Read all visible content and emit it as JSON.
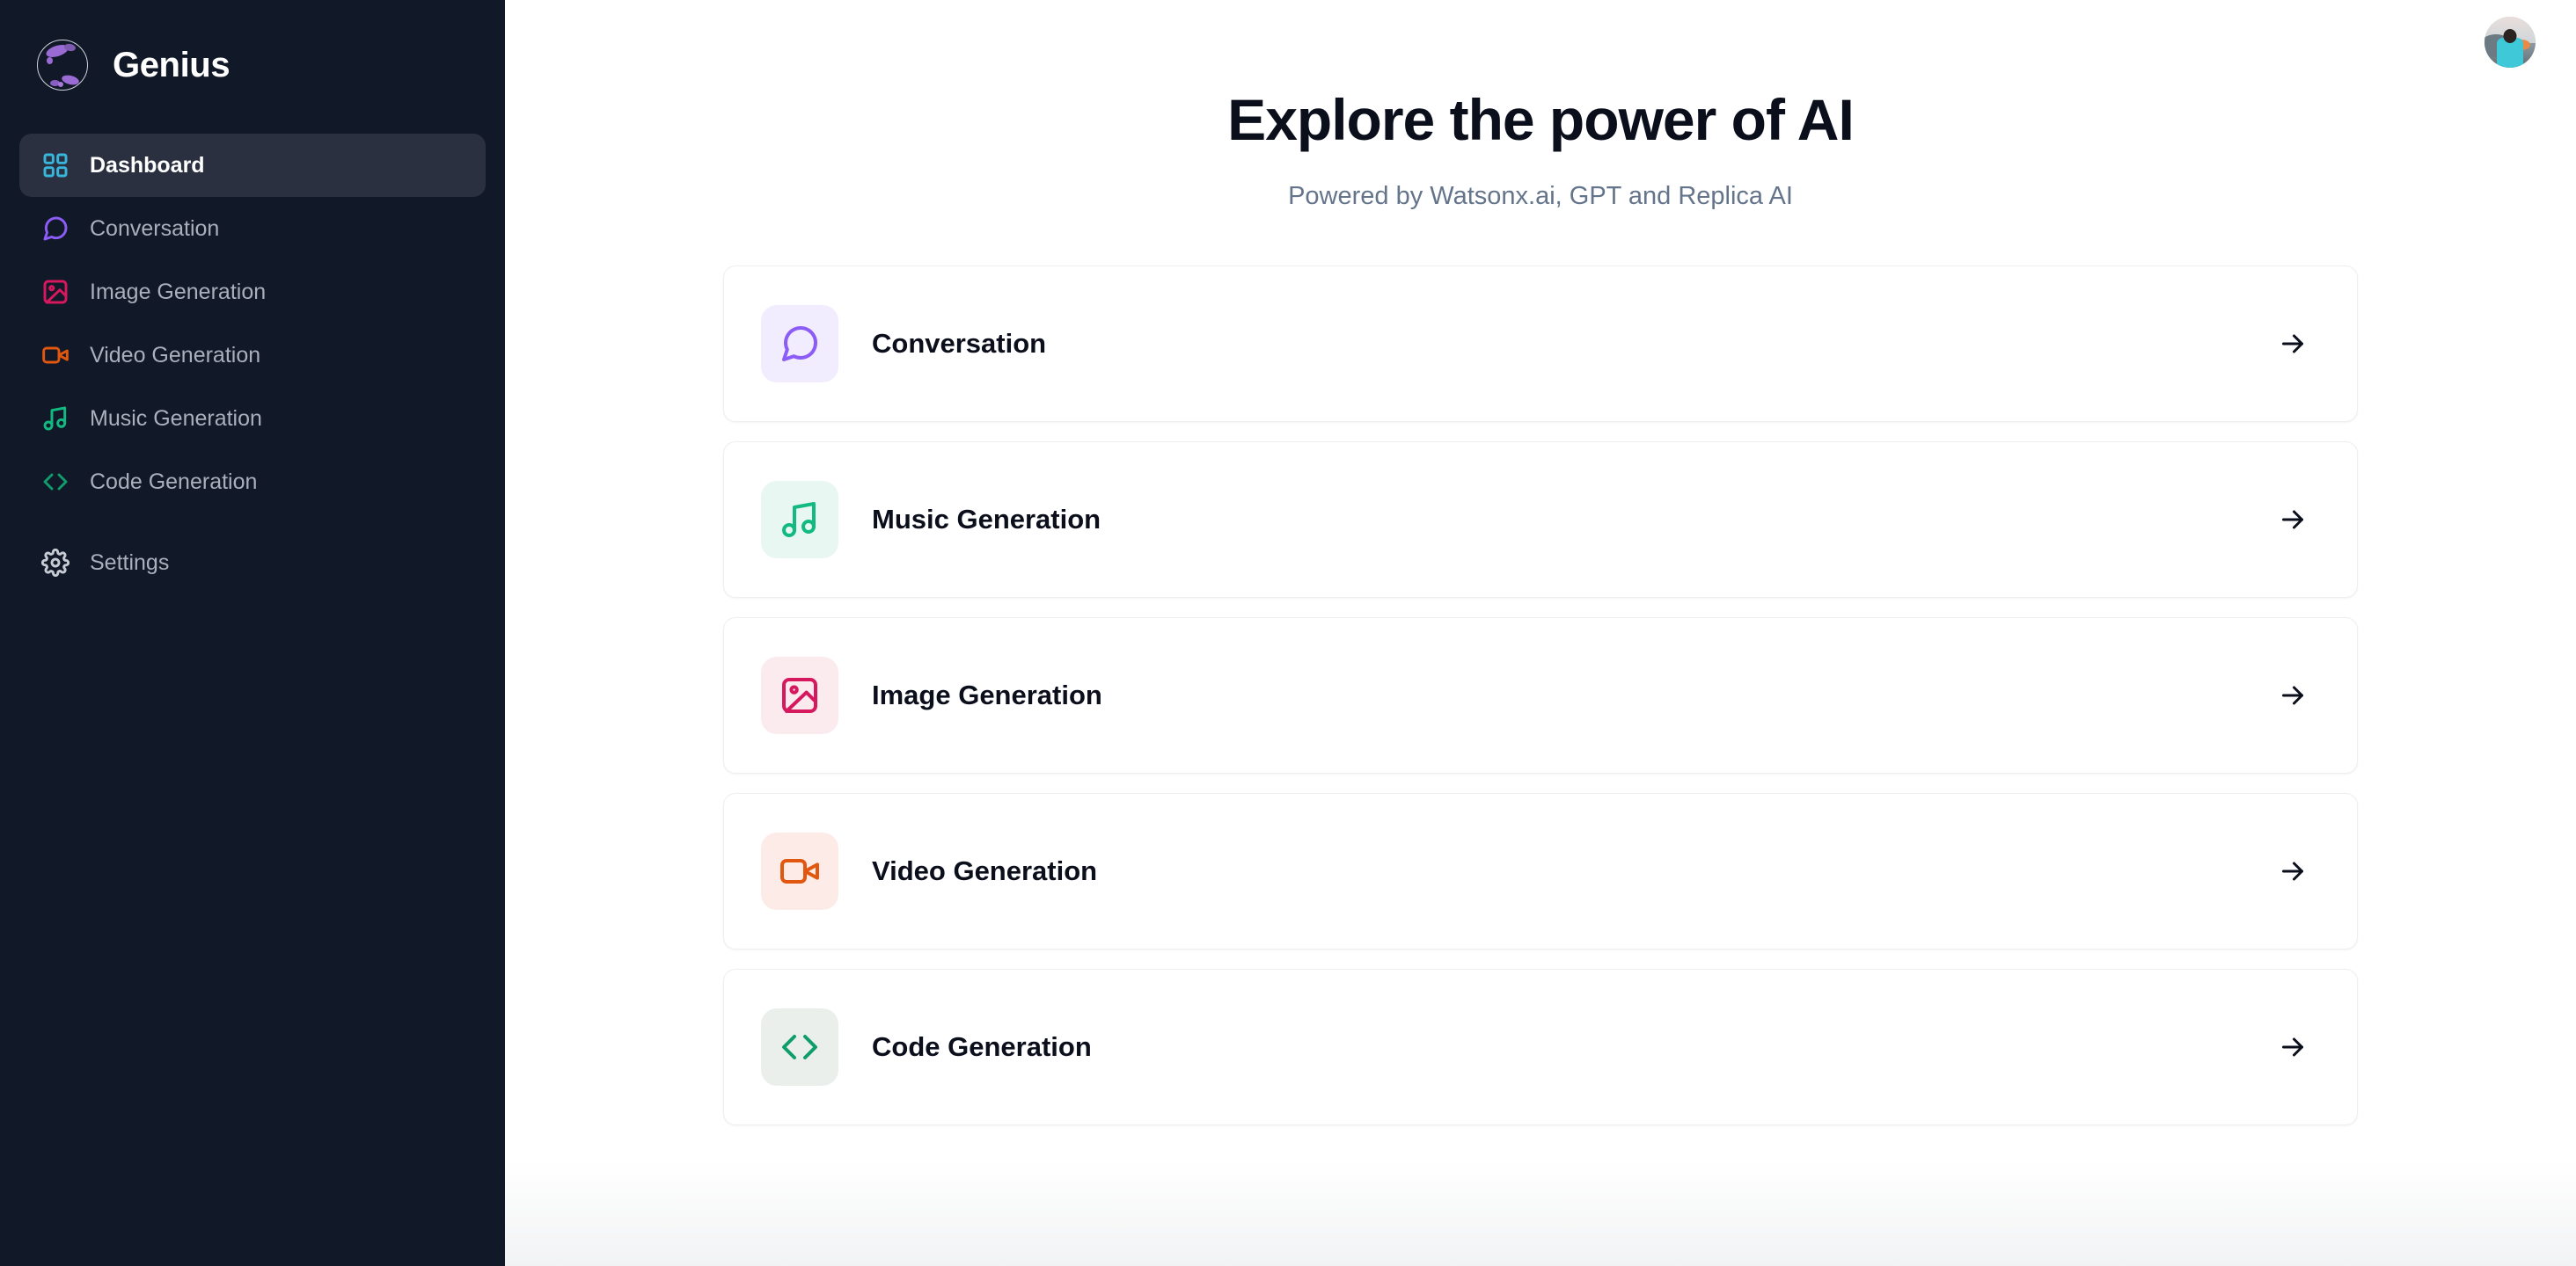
{
  "brand": {
    "name": "Genius",
    "logo_icon": "genius-orb-logo"
  },
  "sidebar": {
    "items": [
      {
        "label": "Dashboard",
        "icon": "layout-dashboard-icon",
        "color": "#38B6DC",
        "active": true
      },
      {
        "label": "Conversation",
        "icon": "message-square-icon",
        "color": "#8B5CF6",
        "active": false
      },
      {
        "label": "Image Generation",
        "icon": "image-icon",
        "color": "#D6185F",
        "active": false
      },
      {
        "label": "Video Generation",
        "icon": "video-camera-icon",
        "color": "#E2570F",
        "active": false
      },
      {
        "label": "Music Generation",
        "icon": "music-note-icon",
        "color": "#12B981",
        "active": false
      },
      {
        "label": "Code Generation",
        "icon": "code-brackets-icon",
        "color": "#0F9D6E",
        "active": false
      },
      {
        "label": "Settings",
        "icon": "gear-icon",
        "color": "#C7CBD4",
        "active": false
      }
    ]
  },
  "topbar": {
    "avatar_icon": "user-avatar"
  },
  "main": {
    "title": "Explore the power of AI",
    "subtitle": "Powered by Watsonx.ai, GPT and Replica AI",
    "cards": [
      {
        "label": "Conversation",
        "icon": "message-square-icon",
        "color": "#8B5CF6",
        "bg": "#F1ECFE",
        "arrow_icon": "arrow-right-icon"
      },
      {
        "label": "Music Generation",
        "icon": "music-note-icon",
        "color": "#12B981",
        "bg": "#E8F7F1",
        "arrow_icon": "arrow-right-icon"
      },
      {
        "label": "Image Generation",
        "icon": "image-icon",
        "color": "#D6185F",
        "bg": "#FBEAEE",
        "arrow_icon": "arrow-right-icon"
      },
      {
        "label": "Video Generation",
        "icon": "video-camera-icon",
        "color": "#E2570F",
        "bg": "#FCEBE6",
        "arrow_icon": "arrow-right-icon"
      },
      {
        "label": "Code Generation",
        "icon": "code-brackets-icon",
        "color": "#0F9D6E",
        "bg": "#EBEFEC",
        "arrow_icon": "arrow-right-icon"
      }
    ]
  },
  "colors": {
    "sidebar_bg": "#111827",
    "sidebar_active_bg": "#2A3040",
    "sidebar_text": "#A9AFBC",
    "title": "#0B0F1C",
    "subtitle": "#64748B",
    "card_border": "#ECEEF1"
  }
}
